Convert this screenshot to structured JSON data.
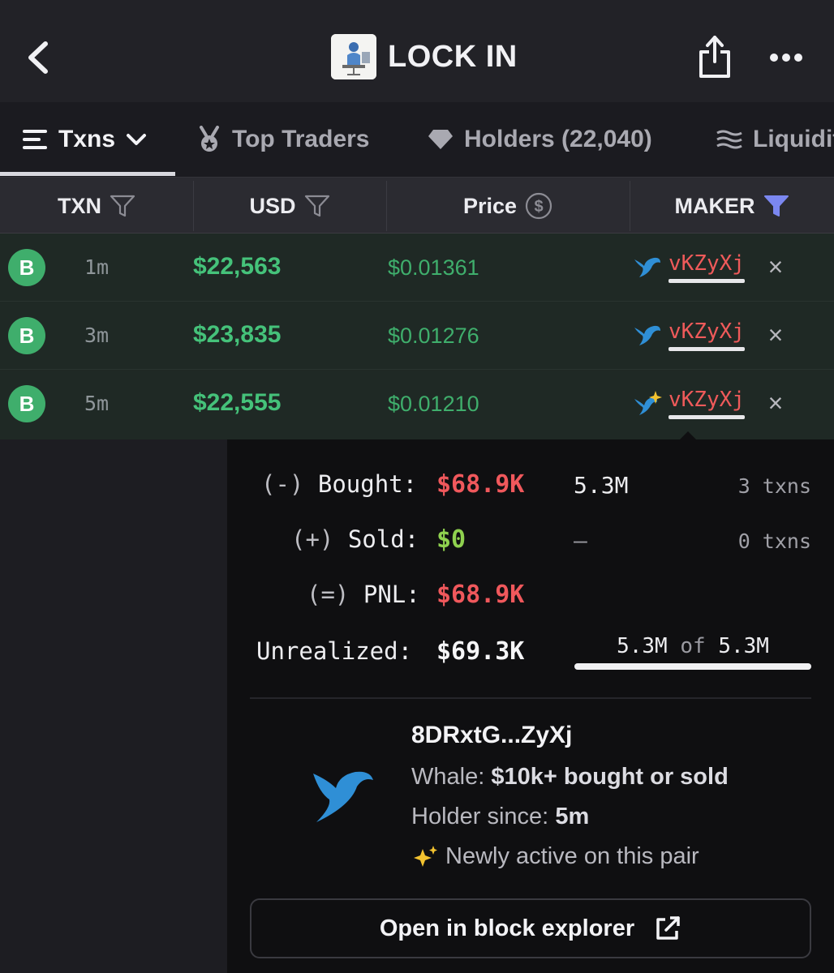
{
  "app": {
    "title": "LOCK IN"
  },
  "tabs": [
    {
      "label": "Txns"
    },
    {
      "label": "Top Traders"
    },
    {
      "label": "Holders (22,040)"
    },
    {
      "label": "Liquidity"
    }
  ],
  "table": {
    "columns": [
      "TXN",
      "USD",
      "Price",
      "MAKER"
    ],
    "rows": [
      {
        "type": "B",
        "age": "1m",
        "usd": "$22,563",
        "price": "$0.01361",
        "maker": "vKZyXj",
        "maker_icon": "whale-icon"
      },
      {
        "type": "B",
        "age": "3m",
        "usd": "$23,835",
        "price": "$0.01276",
        "maker": "vKZyXj",
        "maker_icon": "whale-icon"
      },
      {
        "type": "B",
        "age": "5m",
        "usd": "$22,555",
        "price": "$0.01210",
        "maker": "vKZyXj",
        "maker_icon": "whale-sparkle-icon"
      }
    ]
  },
  "popover": {
    "bought": {
      "prefix": "(-)",
      "label": "Bought:",
      "usd": "$68.9K",
      "amount": "5.3M",
      "txns": "3 txns"
    },
    "sold": {
      "prefix": "(+)",
      "label": "Sold:",
      "usd": "$0",
      "amount": "–",
      "txns": "0 txns"
    },
    "pnl": {
      "prefix": "(=)",
      "label": "PNL:",
      "usd": "$68.9K"
    },
    "unrealized": {
      "label": "Unrealized:",
      "usd": "$69.3K",
      "held": "5.3M",
      "of": "of",
      "total": "5.3M",
      "fraction": 1.0
    },
    "address": "8DRxtG...ZyXj",
    "whale_label": "Whale:",
    "whale_value": "$10k+ bought or sold",
    "holder_label": "Holder since:",
    "holder_value": "5m",
    "new_active": "Newly active on this pair",
    "explorer_button": "Open in block explorer"
  },
  "colors": {
    "buy_green": "#45c27a",
    "sell_red": "#f0585c",
    "maker_filter": "#7b87f0"
  }
}
